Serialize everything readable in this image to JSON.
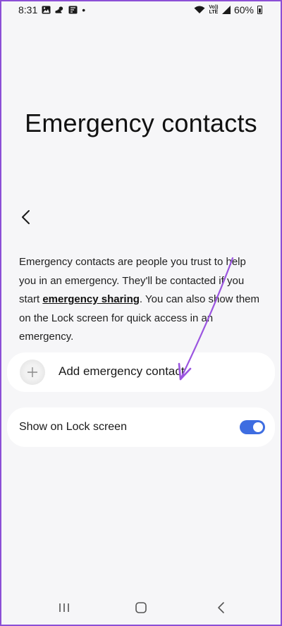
{
  "status_bar": {
    "time": "8:31",
    "battery_percent": "60%",
    "network_label_top": "Vo))",
    "network_label_bottom": "LTE",
    "dot": "•"
  },
  "page": {
    "title": "Emergency contacts",
    "description_before": "Emergency contacts are people you trust to help you in an emergency. They'll be contacted if you start ",
    "description_link": "emergency sharing",
    "description_after": ". You can also show them on the Lock screen for quick access in an emergency."
  },
  "add_contact": {
    "label": "Add emergency contact"
  },
  "lock_screen": {
    "label": "Show on Lock screen",
    "enabled": true
  },
  "colors": {
    "frame": "#8c4fd6",
    "background": "#f6f6f8",
    "toggle_on": "#3e6de1",
    "annotation_arrow": "#9b55e0"
  },
  "icons": {
    "back": "chevron-left-icon",
    "add": "plus-icon",
    "nav_recents": "recents-icon",
    "nav_home": "home-icon",
    "nav_back": "back-icon"
  }
}
